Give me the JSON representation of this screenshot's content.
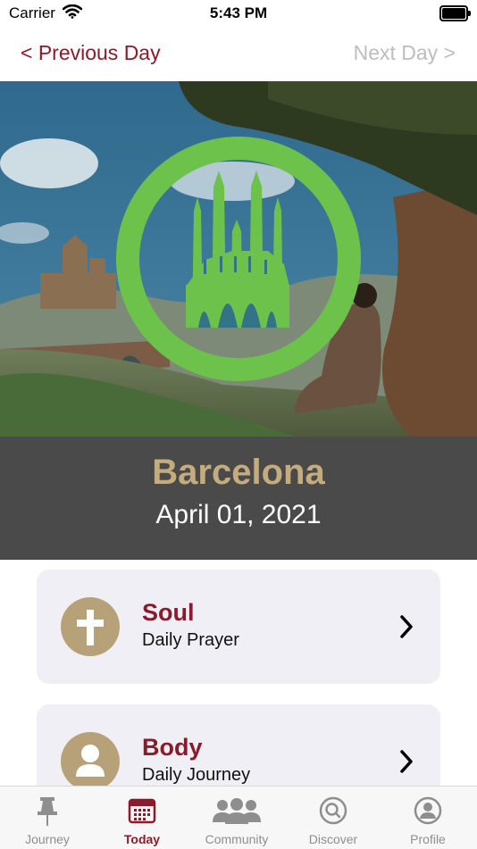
{
  "status_bar": {
    "carrier": "Carrier",
    "time": "5:43 PM",
    "icons": [
      "wifi-icon",
      "battery-icon"
    ]
  },
  "nav": {
    "previous_label": "< Previous Day",
    "next_label": "Next Day >"
  },
  "hero": {
    "badge_icon": "sagrada-familia-icon",
    "badge_color": "#6cc24a"
  },
  "banner": {
    "city": "Barcelona",
    "date": "April 01, 2021",
    "city_color": "#c4ac7f",
    "background": "#4a4a4a"
  },
  "cards": [
    {
      "title": "Soul",
      "subtitle": "Daily Prayer",
      "icon": "cross-icon"
    },
    {
      "title": "Body",
      "subtitle": "Daily Journey",
      "icon": "person-icon"
    }
  ],
  "tabs": [
    {
      "label": "Journey",
      "icon": "pin-icon",
      "active": false
    },
    {
      "label": "Today",
      "icon": "calendar-icon",
      "active": true
    },
    {
      "label": "Community",
      "icon": "people-icon",
      "active": false
    },
    {
      "label": "Discover",
      "icon": "discover-icon",
      "active": false
    },
    {
      "label": "Profile",
      "icon": "profile-icon",
      "active": false
    }
  ],
  "colors": {
    "accent": "#8b1a2b",
    "icon_gold": "#b7a178",
    "inactive": "#8e8e8e"
  }
}
